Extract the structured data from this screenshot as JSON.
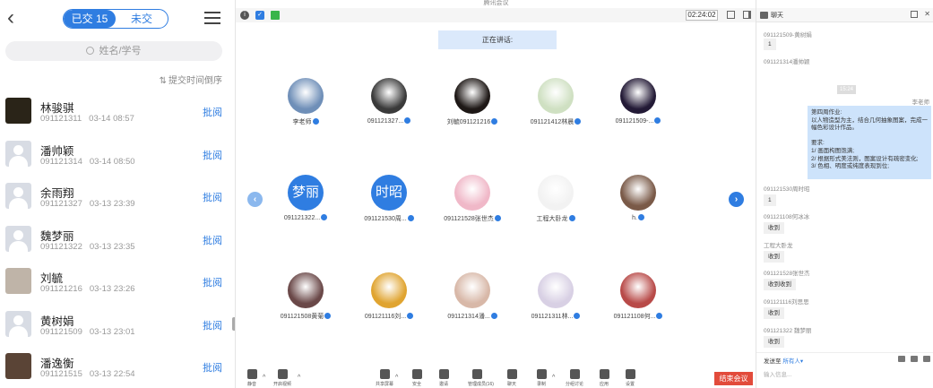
{
  "phone": {
    "back_icon": "chevron-left-icon",
    "tab_submitted": "已交 15",
    "tab_unsubmitted": "未交",
    "search_placeholder": "姓名/学号",
    "sort_label": "提交时间倒序",
    "students": [
      {
        "name": "林骏骐",
        "id": "091121311",
        "time": "03-14 08:57",
        "action": "批阅",
        "avatar": "photo",
        "color": "#2a2418"
      },
      {
        "name": "潘帅颖",
        "id": "091121314",
        "time": "03-14 08:50",
        "action": "批阅",
        "avatar": "default"
      },
      {
        "name": "余雨翔",
        "id": "091121327",
        "time": "03-13 23:39",
        "action": "批阅",
        "avatar": "default"
      },
      {
        "name": "魏梦丽",
        "id": "091121322",
        "time": "03-13 23:35",
        "action": "批阅",
        "avatar": "default"
      },
      {
        "name": "刘毓",
        "id": "091121216",
        "time": "03-13 23:26",
        "action": "批阅",
        "avatar": "photo",
        "color": "#bfb4a8"
      },
      {
        "name": "黄树娟",
        "id": "091121509",
        "time": "03-13 23:01",
        "action": "批阅",
        "avatar": "default"
      },
      {
        "name": "潘逸衡",
        "id": "091121515",
        "time": "03-13 22:54",
        "action": "批阅",
        "avatar": "photo",
        "color": "#5a4436"
      }
    ]
  },
  "meeting": {
    "window_title": "腾讯会议",
    "timer": "02:24:02",
    "speaking": "正在讲话:",
    "participants": [
      {
        "label": "李老师",
        "type": "photo",
        "color": "#6f8fb8"
      },
      {
        "label": "091121327...",
        "type": "photo",
        "color": "#3a3a3a"
      },
      {
        "label": "刘毓091121216",
        "type": "photo",
        "color": "#1e1816"
      },
      {
        "label": "091121412林晨",
        "type": "photo",
        "color": "#cfe0c2"
      },
      {
        "label": "091121509-...",
        "type": "photo",
        "color": "#231a36"
      },
      {
        "label": "091121322...",
        "type": "initials",
        "initials": "梦丽"
      },
      {
        "label": "091121530周...",
        "type": "initials",
        "initials": "时昭"
      },
      {
        "label": "091121528张世杰",
        "type": "photo",
        "color": "#f0b8c8"
      },
      {
        "label": "工程大卧龙",
        "type": "photo",
        "color": "#f2f2f2"
      },
      {
        "label": "h.",
        "type": "photo",
        "color": "#7a5a48"
      },
      {
        "label": "091121508黄菊",
        "type": "photo",
        "color": "#6a4848"
      },
      {
        "label": "091121116刘...",
        "type": "photo",
        "color": "#e0a430"
      },
      {
        "label": "091121314潘...",
        "type": "photo",
        "color": "#d8b8a8"
      },
      {
        "label": "091121311林...",
        "type": "photo",
        "color": "#d8d0e4"
      },
      {
        "label": "091121108何...",
        "type": "photo",
        "color": "#b84a48"
      }
    ],
    "toolbar": [
      {
        "label": "静音",
        "icon": "microphone-icon"
      },
      {
        "label": "开启视频",
        "icon": "video-off-icon"
      },
      {
        "label": "共享屏幕",
        "icon": "screen-share-icon"
      },
      {
        "label": "安全",
        "icon": "shield-icon"
      },
      {
        "label": "邀请",
        "icon": "invite-icon"
      },
      {
        "label": "管理成员(16)",
        "icon": "members-icon"
      },
      {
        "label": "聊天",
        "icon": "chat-icon"
      },
      {
        "label": "录制",
        "icon": "record-icon"
      },
      {
        "label": "分组讨论",
        "icon": "breakout-icon"
      },
      {
        "label": "应用",
        "icon": "apps-icon"
      },
      {
        "label": "设置",
        "icon": "settings-icon"
      }
    ],
    "end_button": "结束会议"
  },
  "chat": {
    "title": "聊天",
    "messages": [
      {
        "name": "091121509-黄树娟",
        "text": "1"
      },
      {
        "name": "091121314潘帅颖",
        "text": ""
      }
    ],
    "timestamp": "15:24",
    "teacher_name": "李老师",
    "teacher_lines": [
      "第四周作业:",
      "以人物造型为主，结合几何抽象图案，完成一幅色彩设计作品。",
      "",
      "要求:",
      "1/ 画面构图饱满;",
      "2/ 根据形式美法则，图案设计有疏密变化;",
      "3/ 色相、明度或纯度表现到位;"
    ],
    "replies": [
      {
        "name": "091121530周时昭",
        "text": "1"
      },
      {
        "name": "091121108何冰冰",
        "text": "收到"
      },
      {
        "name": "工程大卧龙",
        "text": "收到"
      },
      {
        "name": "091121528张世杰",
        "text": "收到收到"
      },
      {
        "name": "091121116刘思思",
        "text": "收到"
      },
      {
        "name": "091121322 魏梦丽",
        "text": "收到"
      }
    ],
    "send_to_label": "发送至",
    "send_to_value": "所有人",
    "input_placeholder": "输入信息..."
  }
}
